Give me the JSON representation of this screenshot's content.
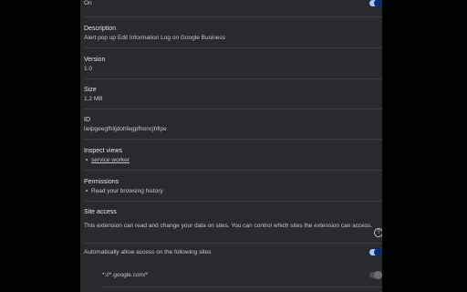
{
  "on_label": "On",
  "description": {
    "label": "Description",
    "value": "Alert pop up Edit Information Log on Google Business"
  },
  "version": {
    "label": "Version",
    "value": "1.0"
  },
  "size": {
    "label": "Size",
    "value": "1.2 MB"
  },
  "id": {
    "label": "ID",
    "value": "lielpgeegfhlijdohfegpfhoncjhflpe"
  },
  "inspect_views": {
    "label": "Inspect views",
    "items": [
      "service worker"
    ]
  },
  "permissions": {
    "label": "Permissions",
    "items": [
      "Read your browsing history"
    ]
  },
  "site_access": {
    "label": "Site access",
    "description": "This extension can read and change your data on sites. You can control which sites the extension can access.",
    "auto_allow_label": "Automatically allow access on the following sites",
    "sites": [
      "*://*.google.com/*"
    ]
  },
  "colors": {
    "panel": "#292a2d",
    "toggle_on": "#a8c7fa",
    "background": "#000000"
  }
}
